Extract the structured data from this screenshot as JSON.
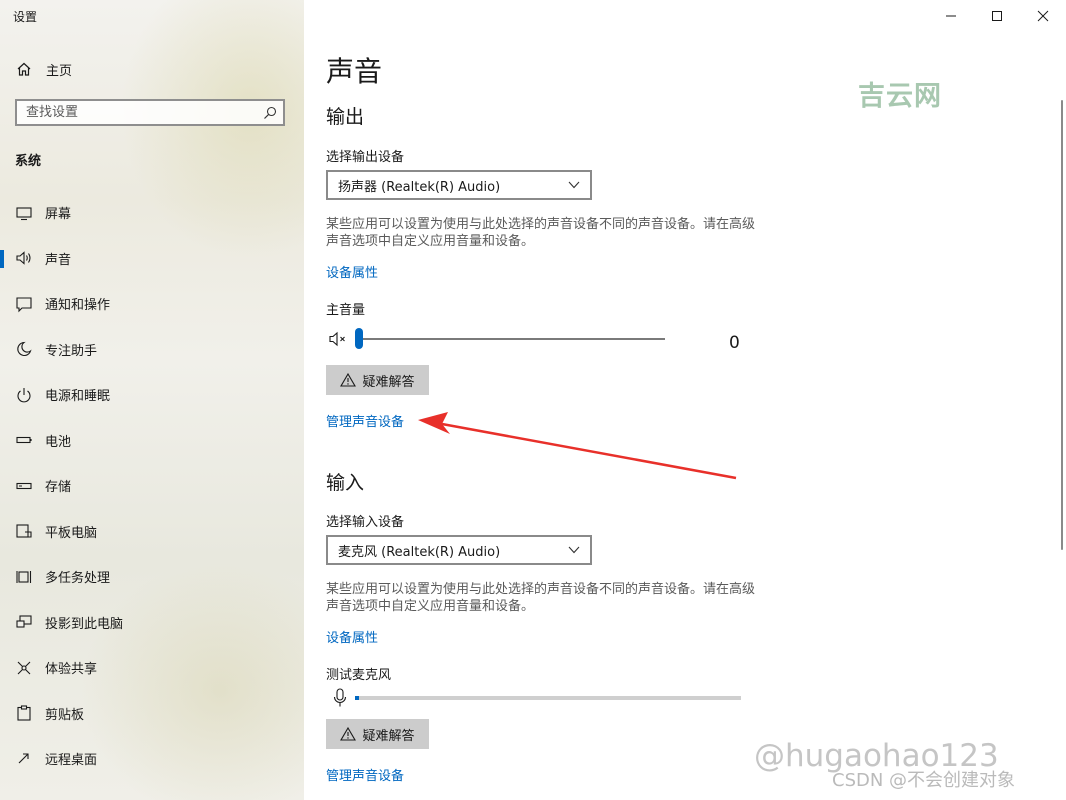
{
  "app": {
    "title": "设置"
  },
  "sidebar": {
    "home_label": "主页",
    "search_placeholder": "查找设置",
    "section": "系统",
    "active_index": 1,
    "items": [
      {
        "label": "屏幕",
        "icon": "monitor-icon"
      },
      {
        "label": "声音",
        "icon": "speaker-icon"
      },
      {
        "label": "通知和操作",
        "icon": "notification-icon"
      },
      {
        "label": "专注助手",
        "icon": "moon-icon"
      },
      {
        "label": "电源和睡眠",
        "icon": "power-icon"
      },
      {
        "label": "电池",
        "icon": "battery-icon"
      },
      {
        "label": "存储",
        "icon": "storage-icon"
      },
      {
        "label": "平板电脑",
        "icon": "tablet-icon"
      },
      {
        "label": "多任务处理",
        "icon": "multitask-icon"
      },
      {
        "label": "投影到此电脑",
        "icon": "project-icon"
      },
      {
        "label": "体验共享",
        "icon": "share-icon"
      },
      {
        "label": "剪贴板",
        "icon": "clipboard-icon"
      },
      {
        "label": "远程桌面",
        "icon": "remote-desktop-icon"
      }
    ]
  },
  "main": {
    "title": "声音",
    "watermark_top": "吉云网",
    "output": {
      "heading": "输出",
      "device_label": "选择输出设备",
      "device_value": "扬声器 (Realtek(R) Audio)",
      "description": "某些应用可以设置为使用与此处选择的声音设备不同的声音设备。请在高级声音选项中自定义应用音量和设备。",
      "properties_link": "设备属性",
      "volume_label": "主音量",
      "volume_value": "0",
      "volume_level": 0,
      "troubleshoot_label": "疑难解答",
      "manage_link": "管理声音设备"
    },
    "input": {
      "heading": "输入",
      "device_label": "选择输入设备",
      "device_value": "麦克风 (Realtek(R) Audio)",
      "description": "某些应用可以设置为使用与此处选择的声音设备不同的声音设备。请在高级声音选项中自定义应用音量和设备。",
      "properties_link": "设备属性",
      "test_label": "测试麦克风",
      "mic_level": 0.01,
      "troubleshoot_label": "疑难解答",
      "manage_link": "管理声音设备"
    },
    "watermark_bottom": "@hugaohao123",
    "watermark_bottom2": "CSDN @不会创建对象"
  },
  "colors": {
    "accent": "#0067c0",
    "annotation_arrow": "#e8302a"
  }
}
